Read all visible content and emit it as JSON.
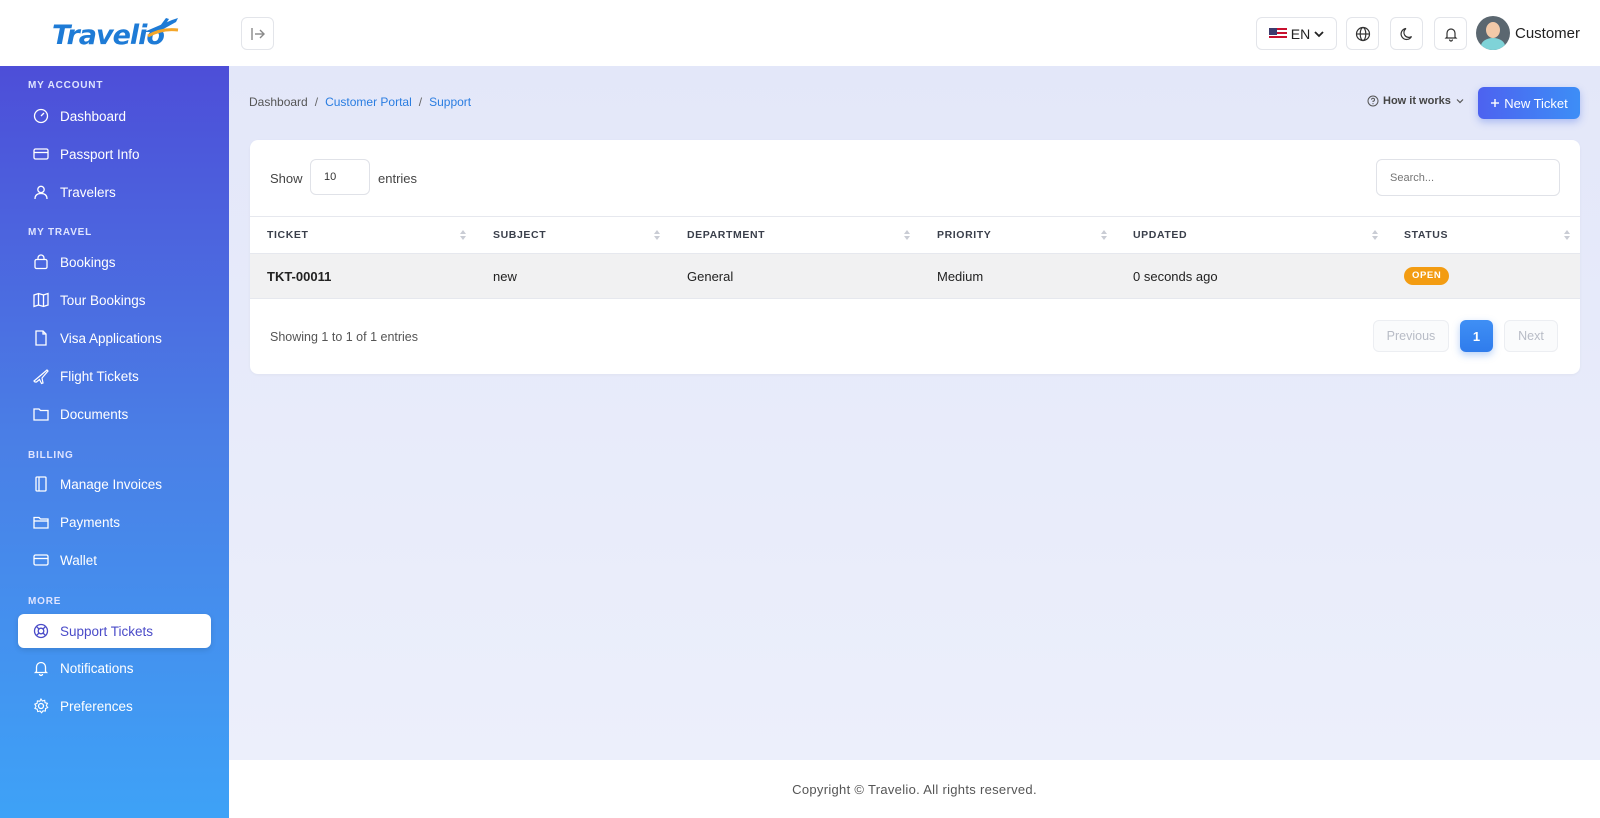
{
  "app": {
    "brand": "Travelio"
  },
  "header": {
    "language": "EN",
    "user_name": "Customer"
  },
  "sidebar": {
    "sections": [
      {
        "label": "MY ACCOUNT",
        "items": [
          {
            "label": "Dashboard",
            "icon": "dashboard-gauge-icon"
          },
          {
            "label": "Passport Info",
            "icon": "id-card-icon"
          },
          {
            "label": "Travelers",
            "icon": "user-icon"
          }
        ]
      },
      {
        "label": "MY TRAVEL",
        "items": [
          {
            "label": "Bookings",
            "icon": "bag-icon"
          },
          {
            "label": "Tour Bookings",
            "icon": "map-icon"
          },
          {
            "label": "Visa Applications",
            "icon": "document-icon"
          },
          {
            "label": "Flight Tickets",
            "icon": "plane-icon"
          },
          {
            "label": "Documents",
            "icon": "folder-icon"
          }
        ]
      },
      {
        "label": "BILLING",
        "items": [
          {
            "label": "Manage Invoices",
            "icon": "invoice-icon"
          },
          {
            "label": "Payments",
            "icon": "wallet-folder-icon"
          },
          {
            "label": "Wallet",
            "icon": "card-icon"
          }
        ]
      },
      {
        "label": "MORE",
        "items": [
          {
            "label": "Support Tickets",
            "icon": "lifebuoy-icon",
            "active": true
          },
          {
            "label": "Notifications",
            "icon": "bell-icon"
          },
          {
            "label": "Preferences",
            "icon": "gear-icon"
          }
        ]
      }
    ]
  },
  "breadcrumb": {
    "items": [
      "Dashboard",
      "Customer Portal",
      "Support"
    ],
    "separator": "/"
  },
  "actions": {
    "how_it_works": "How it works",
    "new_ticket": "New Ticket"
  },
  "table": {
    "show_label": "Show",
    "page_size": "10",
    "entries_label": "entries",
    "search_placeholder": "Search...",
    "columns": [
      "TICKET",
      "SUBJECT",
      "DEPARTMENT",
      "PRIORITY",
      "UPDATED",
      "STATUS"
    ],
    "rows": [
      {
        "ticket": "TKT-00011",
        "subject": "new",
        "department": "General",
        "priority": "Medium",
        "updated": "0 seconds ago",
        "status": "OPEN"
      }
    ],
    "showing": "Showing 1 to 1 of 1 entries",
    "pagination": {
      "previous": "Previous",
      "current": "1",
      "next": "Next"
    }
  },
  "footer": {
    "copyright": "Copyright © Travelio. All rights reserved."
  },
  "colors": {
    "accent": "#3d8ef6",
    "sidebar_top": "#4d4ed8",
    "sidebar_bottom": "#3ea2f7",
    "status_open": "#f39c12"
  }
}
